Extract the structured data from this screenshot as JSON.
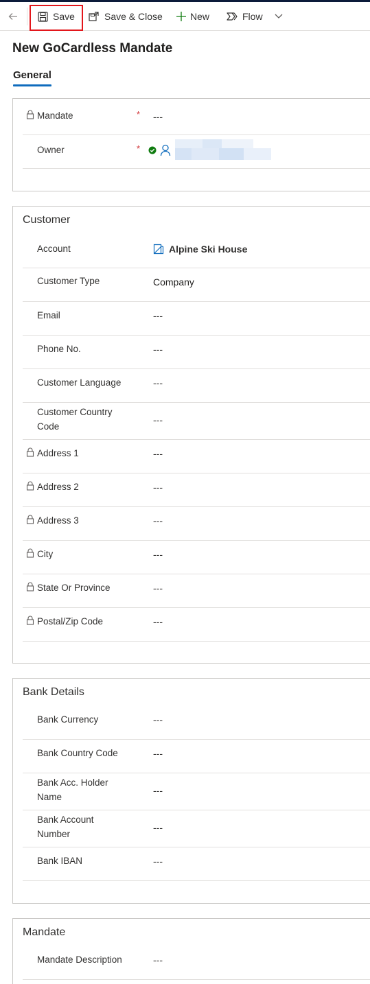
{
  "toolbar": {
    "save_label": "Save",
    "save_close_label": "Save & Close",
    "new_label": "New",
    "flow_label": "Flow"
  },
  "page": {
    "title": "New GoCardless Mandate",
    "tab_general": "General"
  },
  "general": {
    "rows": [
      {
        "label": "Mandate",
        "value": "---",
        "required": "*"
      },
      {
        "label": "Owner",
        "value": "",
        "required": "*"
      }
    ]
  },
  "customer": {
    "title": "Customer",
    "rows": [
      {
        "label": "Account",
        "value": "Alpine Ski House"
      },
      {
        "label": "Customer Type",
        "value": "Company"
      },
      {
        "label": "Email",
        "value": "---"
      },
      {
        "label": "Phone No.",
        "value": "---"
      },
      {
        "label": "Customer Language",
        "value": "---"
      },
      {
        "label": "Customer Country",
        "label2": "Code",
        "value": "---"
      },
      {
        "label": "Address 1",
        "value": "---"
      },
      {
        "label": "Address 2",
        "value": "---"
      },
      {
        "label": "Address 3",
        "value": "---"
      },
      {
        "label": "City",
        "value": "---"
      },
      {
        "label": "State Or Province",
        "value": "---"
      },
      {
        "label": "Postal/Zip Code",
        "value": "---"
      }
    ]
  },
  "bank": {
    "title": "Bank Details",
    "rows": [
      {
        "label": "Bank Currency",
        "value": "---"
      },
      {
        "label": "Bank Country Code",
        "value": "---"
      },
      {
        "label": "Bank Acc. Holder",
        "label2": "Name",
        "value": "---"
      },
      {
        "label": "Bank Account",
        "label2": "Number",
        "value": "---"
      },
      {
        "label": "Bank IBAN",
        "value": "---"
      }
    ]
  },
  "mandate": {
    "title": "Mandate",
    "rows": [
      {
        "label": "Mandate Description",
        "value": "---"
      }
    ]
  },
  "colors": {
    "accent": "#0f6cbd",
    "link": "#115ea3",
    "required": "#d13438",
    "highlight": "#e3161b",
    "success": "#107c10"
  }
}
